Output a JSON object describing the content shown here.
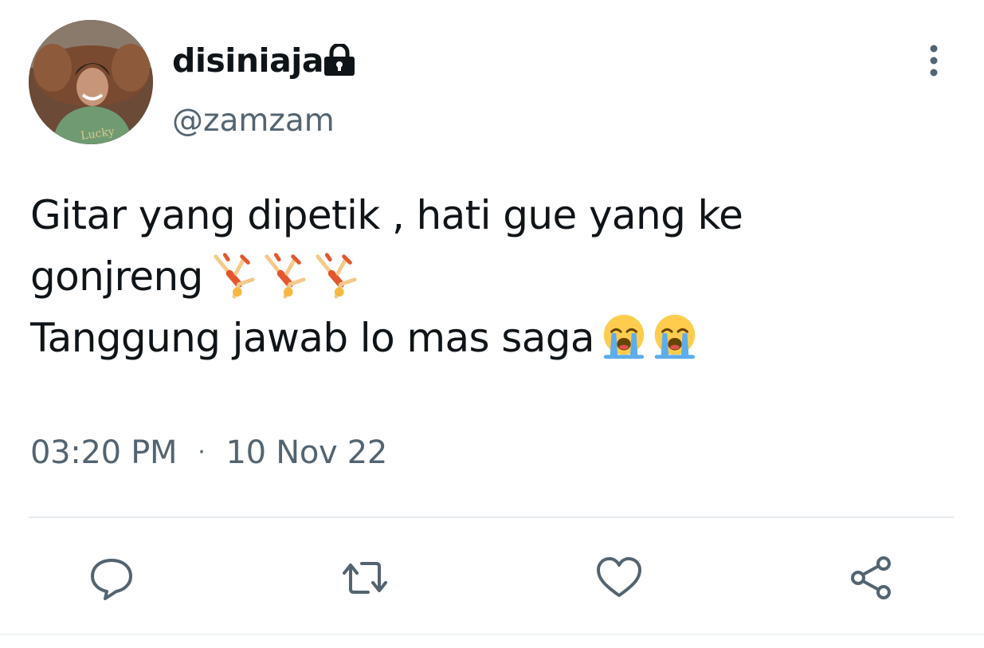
{
  "user": {
    "display_name": "disiniaja",
    "handle": "@zamzam",
    "protected_icon": "lock-icon",
    "avatar_print": "Lucky"
  },
  "tweet": {
    "lines": [
      "Gitar yang dipetik , hati gue yang ke",
      "gonjreng",
      "Tanggung jawab lo mas saga"
    ],
    "emoji": {
      "line2": [
        "person-cartwheeling-emoji",
        "person-cartwheeling-emoji",
        "person-cartwheeling-emoji"
      ],
      "line3": [
        "loudly-crying-face-emoji",
        "loudly-crying-face-emoji"
      ]
    },
    "time": "03:20 PM",
    "separator": "·",
    "date": "10 Nov 22"
  },
  "actions": {
    "icons": [
      "reply-icon",
      "retweet-icon",
      "like-icon",
      "share-icon"
    ]
  },
  "colors": {
    "text_primary": "#0f1419",
    "text_secondary": "#536471",
    "icon": "#536471",
    "divider": "#e6ecf0"
  }
}
